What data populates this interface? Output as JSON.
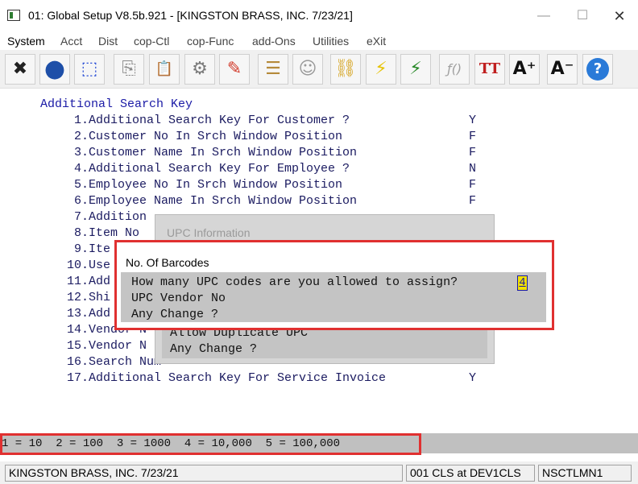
{
  "window": {
    "title": "01: Global Setup V8.5b.921 - [KINGSTON BRASS, INC. 7/23/21]",
    "minimize": "—",
    "maximize": "☐",
    "close": "✕"
  },
  "menu": {
    "items": [
      {
        "label": "System"
      },
      {
        "label": "Acct"
      },
      {
        "label": "Dist"
      },
      {
        "label": "cop-Ctl"
      },
      {
        "label": "cop-Func"
      },
      {
        "label": "add-Ons"
      },
      {
        "label": "Utilities"
      },
      {
        "label": "eXit"
      }
    ]
  },
  "toolbar": {
    "buttons": [
      {
        "icon": "close-x-icon",
        "glyph": "✖",
        "color": "#222222"
      },
      {
        "icon": "globe-icon",
        "glyph": "●",
        "color": "#1e4fa8"
      },
      {
        "icon": "select-rectangle-icon",
        "glyph": "⬚",
        "color": "#2b4fd6"
      },
      {
        "icon": "copy-icon",
        "glyph": "⎘",
        "color": "#8a8a8a"
      },
      {
        "icon": "paste-icon",
        "glyph": "📋",
        "color": "#b58a3a"
      },
      {
        "icon": "settings-gear-icon",
        "glyph": "⚙",
        "color": "#7a7a7a"
      },
      {
        "icon": "edit-pencil-icon",
        "glyph": "✎",
        "color": "#d23a2a"
      },
      {
        "icon": "notepad-icon",
        "glyph": "☰",
        "color": "#b58a3a"
      },
      {
        "icon": "users-icon",
        "glyph": "☺",
        "color": "#9a9a9a"
      },
      {
        "icon": "chain-link-icon",
        "glyph": "⛓",
        "color": "#d4a017"
      },
      {
        "icon": "lightning-icon",
        "glyph": "⚡",
        "color": "#e6c200"
      },
      {
        "icon": "window-lightning-icon",
        "glyph": "⚡",
        "color": "#2a8a2a"
      },
      {
        "icon": "function-icon",
        "glyph": "ƒ()",
        "color": "#a0a0a0"
      },
      {
        "icon": "font-size-icon",
        "glyph": "TT",
        "color": "#c02020"
      },
      {
        "icon": "font-increase-icon",
        "glyph": "A⁺",
        "color": "#111111"
      },
      {
        "icon": "font-decrease-icon",
        "glyph": "A⁻",
        "color": "#111111"
      },
      {
        "icon": "help-icon",
        "glyph": "?",
        "color": "#2a7ad8"
      }
    ]
  },
  "screen": {
    "heading": "Additional Search Key",
    "items": [
      {
        "num": "1.",
        "label": "Additional Search Key For Customer ?",
        "value": "Y"
      },
      {
        "num": "2.",
        "label": "Customer No In Srch Window Position",
        "value": "F"
      },
      {
        "num": "3.",
        "label": "Customer Name In Srch Window Position",
        "value": "F"
      },
      {
        "num": "4.",
        "label": "Additional Search Key For Employee ?",
        "value": "N"
      },
      {
        "num": "5.",
        "label": "Employee No In Srch Window Position",
        "value": "F"
      },
      {
        "num": "6.",
        "label": "Employee Name In Srch Window Position",
        "value": "F"
      },
      {
        "num": "7.",
        "label": "Addition",
        "value": ""
      },
      {
        "num": "8.",
        "label": "Item No",
        "value": ""
      },
      {
        "num": "9.",
        "label": "Ite",
        "value": ""
      },
      {
        "num": "10.",
        "label": "Use",
        "value": ""
      },
      {
        "num": "11.",
        "label": "Add",
        "value": ""
      },
      {
        "num": "12.",
        "label": "Shi",
        "value": ""
      },
      {
        "num": "13.",
        "label": "Add",
        "value": ""
      },
      {
        "num": "14.",
        "label": "Vendor N",
        "value": ""
      },
      {
        "num": "15.",
        "label": "Vendor N",
        "value": ""
      },
      {
        "num": "16.",
        "label": "Search Num",
        "value": ""
      },
      {
        "num": "17.",
        "label": "Additional Search Key For Service Invoice",
        "value": "Y"
      }
    ]
  },
  "upc_window": {
    "title": "UPC Information",
    "lines": [
      "Allow Duplicate UPC",
      "Any Change ?"
    ]
  },
  "barcodes_dialog": {
    "title": "No. Of Barcodes",
    "question": "How many UPC codes are you allowed to assign?",
    "value": "4",
    "line2": "UPC Vendor No",
    "line3": "Any Change ?"
  },
  "hint": "1 = 10  2 = 100  3 = 1000  4 = 10,000  5 = 100,000",
  "status": {
    "company": "KINGSTON BRASS, INC. 7/23/21",
    "session": "001 CLS at DEV1CLS",
    "program": "NSCTLMN1"
  }
}
